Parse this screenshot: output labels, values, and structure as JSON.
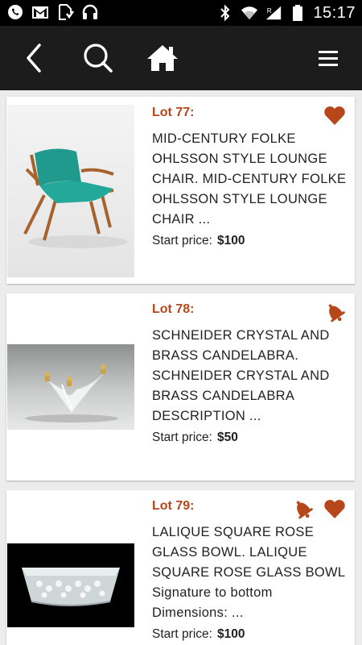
{
  "status_bar": {
    "time": "15:17",
    "left_icons": [
      "whatsapp-icon",
      "gmail-icon",
      "download-icon",
      "headphones-icon"
    ],
    "right_icons": [
      "bluetooth-icon",
      "wifi-icon",
      "signal-icon",
      "battery-icon"
    ]
  },
  "toolbar": {
    "icons": [
      "back-arrow-icon",
      "search-icon",
      "home-icon",
      "menu-icon"
    ]
  },
  "colors": {
    "accent": "#b5471b",
    "toolbar_bg": "#1c1c1c",
    "list_bg": "#ececec"
  },
  "lots": [
    {
      "lot_label": "Lot 77:",
      "description": "MID-CENTURY FOLKE OHLSSON STYLE LOUNGE CHAIR. MID-CENTURY FOLKE OHLSSON STYLE LOUNGE CHAIR ...",
      "price_label": "Start price:",
      "price_value": "$100",
      "badges": [
        "heart-icon"
      ]
    },
    {
      "lot_label": "Lot 78:",
      "description": "SCHNEIDER CRYSTAL AND BRASS CANDELABRA. SCHNEIDER CRYSTAL AND BRASS CANDELABRA DESCRIPTION ...",
      "price_label": "Start price:",
      "price_value": "$50",
      "badges": [
        "bell-icon"
      ]
    },
    {
      "lot_label": "Lot 79:",
      "description": "LALIQUE SQUARE ROSE GLASS BOWL. LALIQUE SQUARE ROSE GLASS BOWL Signature to bottom Dimensions: ...",
      "price_label": "Start price:",
      "price_value": "$100",
      "badges": [
        "bell-icon",
        "heart-icon"
      ]
    }
  ]
}
